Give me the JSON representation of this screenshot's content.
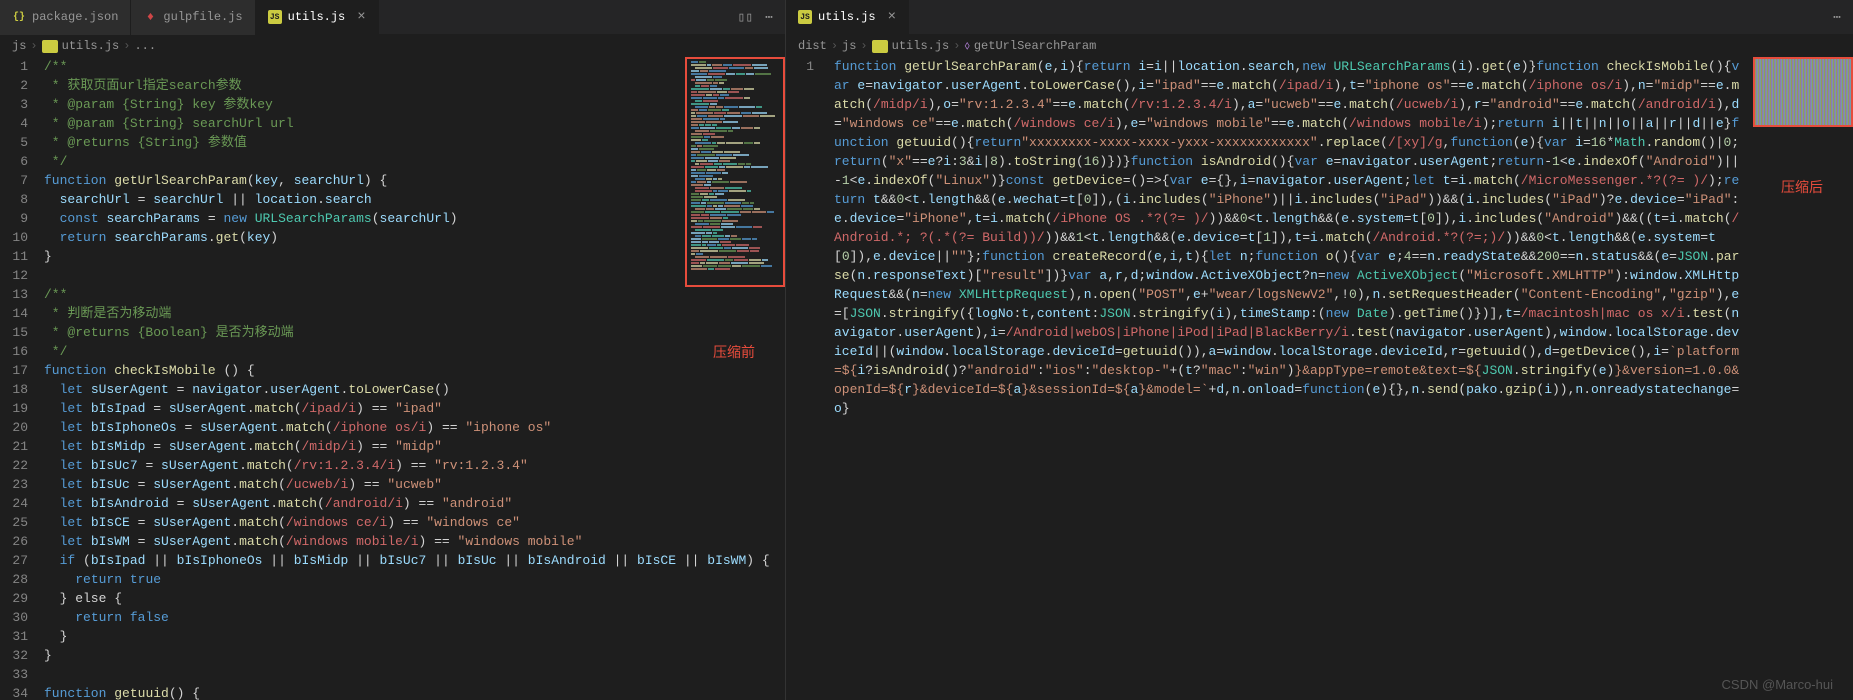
{
  "left": {
    "tabs": [
      {
        "icon": "json",
        "label": "package.json",
        "active": false
      },
      {
        "icon": "gulp",
        "label": "gulpfile.js",
        "active": false
      },
      {
        "icon": "js",
        "label": "utils.js",
        "active": true
      }
    ],
    "breadcrumb": [
      "js",
      "utils.js",
      "..."
    ],
    "minimap_label": "压缩前",
    "lines": [
      {
        "n": 1,
        "t": "/**",
        "cls": "c-comment"
      },
      {
        "n": 2,
        "t": " * 获取页面url指定search参数",
        "cls": "c-comment"
      },
      {
        "n": 3,
        "t": " * @param {String} key 参数key",
        "cls": "c-comment"
      },
      {
        "n": 4,
        "t": " * @param {String} searchUrl url",
        "cls": "c-comment"
      },
      {
        "n": 5,
        "t": " * @returns {String} 参数值",
        "cls": "c-comment"
      },
      {
        "n": 6,
        "t": " */",
        "cls": "c-comment"
      },
      {
        "n": 7,
        "html": "<span class='c-kw'>function</span> <span class='c-fn'>getUrlSearchParam</span>(<span class='c-var'>key</span>, <span class='c-var'>searchUrl</span>) {"
      },
      {
        "n": 8,
        "html": "  <span class='c-var'>searchUrl</span> = <span class='c-var'>searchUrl</span> || <span class='c-var'>location</span>.<span class='c-var'>search</span>"
      },
      {
        "n": 9,
        "html": "  <span class='c-kw'>const</span> <span class='c-var'>searchParams</span> = <span class='c-kw'>new</span> <span class='c-type'>URLSearchParams</span>(<span class='c-var'>searchUrl</span>)"
      },
      {
        "n": 10,
        "html": "  <span class='c-kw'>return</span> <span class='c-var'>searchParams</span>.<span class='c-fn'>get</span>(<span class='c-var'>key</span>)"
      },
      {
        "n": 11,
        "t": "}"
      },
      {
        "n": 12,
        "t": ""
      },
      {
        "n": 13,
        "t": "/**",
        "cls": "c-comment"
      },
      {
        "n": 14,
        "t": " * 判断是否为移动端",
        "cls": "c-comment"
      },
      {
        "n": 15,
        "t": " * @returns {Boolean} 是否为移动端",
        "cls": "c-comment"
      },
      {
        "n": 16,
        "t": " */",
        "cls": "c-comment"
      },
      {
        "n": 17,
        "html": "<span class='c-kw'>function</span> <span class='c-fn'>checkIsMobile</span> () {"
      },
      {
        "n": 18,
        "html": "  <span class='c-kw'>let</span> <span class='c-var'>sUserAgent</span> = <span class='c-var'>navigator</span>.<span class='c-var'>userAgent</span>.<span class='c-fn'>toLowerCase</span>()"
      },
      {
        "n": 19,
        "html": "  <span class='c-kw'>let</span> <span class='c-var'>bIsIpad</span> = <span class='c-var'>sUserAgent</span>.<span class='c-fn'>match</span>(<span class='c-regex'>/ipad/i</span>) == <span class='c-str'>\"ipad\"</span>"
      },
      {
        "n": 20,
        "html": "  <span class='c-kw'>let</span> <span class='c-var'>bIsIphoneOs</span> = <span class='c-var'>sUserAgent</span>.<span class='c-fn'>match</span>(<span class='c-regex'>/iphone os/i</span>) == <span class='c-str'>\"iphone os\"</span>"
      },
      {
        "n": 21,
        "html": "  <span class='c-kw'>let</span> <span class='c-var'>bIsMidp</span> = <span class='c-var'>sUserAgent</span>.<span class='c-fn'>match</span>(<span class='c-regex'>/midp/i</span>) == <span class='c-str'>\"midp\"</span>"
      },
      {
        "n": 22,
        "html": "  <span class='c-kw'>let</span> <span class='c-var'>bIsUc7</span> = <span class='c-var'>sUserAgent</span>.<span class='c-fn'>match</span>(<span class='c-regex'>/rv:1.2.3.4/i</span>) == <span class='c-str'>\"rv:1.2.3.4\"</span>"
      },
      {
        "n": 23,
        "html": "  <span class='c-kw'>let</span> <span class='c-var'>bIsUc</span> = <span class='c-var'>sUserAgent</span>.<span class='c-fn'>match</span>(<span class='c-regex'>/ucweb/i</span>) == <span class='c-str'>\"ucweb\"</span>"
      },
      {
        "n": 24,
        "html": "  <span class='c-kw'>let</span> <span class='c-var'>bIsAndroid</span> = <span class='c-var'>sUserAgent</span>.<span class='c-fn'>match</span>(<span class='c-regex'>/android/i</span>) == <span class='c-str'>\"android\"</span>"
      },
      {
        "n": 25,
        "html": "  <span class='c-kw'>let</span> <span class='c-var'>bIsCE</span> = <span class='c-var'>sUserAgent</span>.<span class='c-fn'>match</span>(<span class='c-regex'>/windows ce/i</span>) == <span class='c-str'>\"windows ce\"</span>"
      },
      {
        "n": 26,
        "html": "  <span class='c-kw'>let</span> <span class='c-var'>bIsWM</span> = <span class='c-var'>sUserAgent</span>.<span class='c-fn'>match</span>(<span class='c-regex'>/windows mobile/i</span>) == <span class='c-str'>\"windows mobile\"</span>"
      },
      {
        "n": 27,
        "html": "  <span class='c-kw'>if</span> (<span class='c-var'>bIsIpad</span> || <span class='c-var'>bIsIphoneOs</span> || <span class='c-var'>bIsMidp</span> || <span class='c-var'>bIsUc7</span> || <span class='c-var'>bIsUc</span> || <span class='c-var'>bIsAndroid</span> || <span class='c-var'>bIsCE</span> || <span class='c-var'>bIsWM</span>) {"
      },
      {
        "n": 28,
        "html": "    <span class='c-kw'>return</span> <span class='c-const'>true</span>"
      },
      {
        "n": 29,
        "t": "  } else {"
      },
      {
        "n": 30,
        "html": "    <span class='c-kw'>return</span> <span class='c-const'>false</span>"
      },
      {
        "n": 31,
        "t": "  }"
      },
      {
        "n": 32,
        "t": "}"
      },
      {
        "n": 33,
        "t": ""
      },
      {
        "n": 34,
        "html": "<span class='c-kw'>function</span> <span class='c-fn'>getuuid</span>() {"
      }
    ]
  },
  "right": {
    "tabs": [
      {
        "icon": "js",
        "label": "utils.js",
        "active": true
      }
    ],
    "breadcrumb": [
      "dist",
      "js",
      "utils.js",
      "getUrlSearchParam"
    ],
    "minimap_label": "压缩后",
    "line_num": "1",
    "code_html": "<span class='c-kw'>function</span> <span class='c-fn'>getUrlSearchParam</span>(<span class='c-var'>e</span>,<span class='c-var'>i</span>){<span class='c-kw'>return</span> <span class='c-var'>i</span>=<span class='c-var'>i</span>||<span class='c-var'>location</span>.<span class='c-var'>search</span>,<span class='c-kw'>new</span> <span class='c-type'>URLSearchParams</span>(<span class='c-var'>i</span>).<span class='c-fn'>get</span>(<span class='c-var'>e</span>)}<span class='c-kw'>function</span> <span class='c-fn'>checkIsMobile</span>(){<span class='c-kw'>var</span> <span class='c-var'>e</span>=<span class='c-var'>navigator</span>.<span class='c-var'>userAgent</span>.<span class='c-fn'>toLowerCase</span>(),<span class='c-var'>i</span>=<span class='c-str'>\"ipad\"</span>==<span class='c-var'>e</span>.<span class='c-fn'>match</span>(<span class='c-regex'>/ipad/i</span>),<span class='c-var'>t</span>=<span class='c-str'>\"iphone os\"</span>==<span class='c-var'>e</span>.<span class='c-fn'>match</span>(<span class='c-regex'>/iphone os/i</span>),<span class='c-var'>n</span>=<span class='c-str'>\"midp\"</span>==<span class='c-var'>e</span>.<span class='c-fn'>match</span>(<span class='c-regex'>/midp/i</span>),<span class='c-var'>o</span>=<span class='c-str'>\"rv:1.2.3.4\"</span>==<span class='c-var'>e</span>.<span class='c-fn'>match</span>(<span class='c-regex'>/rv:1.2.3.4/i</span>),<span class='c-var'>a</span>=<span class='c-str'>\"ucweb\"</span>==<span class='c-var'>e</span>.<span class='c-fn'>match</span>(<span class='c-regex'>/ucweb/i</span>),<span class='c-var'>r</span>=<span class='c-str'>\"android\"</span>==<span class='c-var'>e</span>.<span class='c-fn'>match</span>(<span class='c-regex'>/android/i</span>),<span class='c-var'>d</span>=<span class='c-str'>\"windows ce\"</span>==<span class='c-var'>e</span>.<span class='c-fn'>match</span>(<span class='c-regex'>/windows ce/i</span>),<span class='c-var'>e</span>=<span class='c-str'>\"windows mobile\"</span>==<span class='c-var'>e</span>.<span class='c-fn'>match</span>(<span class='c-regex'>/windows mobile/i</span>);<span class='c-kw'>return</span> <span class='c-var'>i</span>||<span class='c-var'>t</span>||<span class='c-var'>n</span>||<span class='c-var'>o</span>||<span class='c-var'>a</span>||<span class='c-var'>r</span>||<span class='c-var'>d</span>||<span class='c-var'>e</span>}<span class='c-kw'>function</span> <span class='c-fn'>getuuid</span>(){<span class='c-kw'>return</span><span class='c-str'>\"xxxxxxxx-xxxx-xxxx-yxxx-xxxxxxxxxxxx\"</span>.<span class='c-fn'>replace</span>(<span class='c-regex'>/[xy]/g</span>,<span class='c-kw'>function</span>(<span class='c-var'>e</span>){<span class='c-kw'>var</span> <span class='c-var'>i</span>=<span class='c-num'>16</span>*<span class='c-type'>Math</span>.<span class='c-fn'>random</span>()|<span class='c-num'>0</span>;<span class='c-kw'>return</span>(<span class='c-str'>\"x\"</span>==<span class='c-var'>e</span>?<span class='c-var'>i</span>:<span class='c-num'>3</span>&<span class='c-var'>i</span>|<span class='c-num'>8</span>).<span class='c-fn'>toString</span>(<span class='c-num'>16</span>)})}<span class='c-kw'>function</span> <span class='c-fn'>isAndroid</span>(){<span class='c-kw'>var</span> <span class='c-var'>e</span>=<span class='c-var'>navigator</span>.<span class='c-var'>userAgent</span>;<span class='c-kw'>return</span>-<span class='c-num'>1</span>&lt;<span class='c-var'>e</span>.<span class='c-fn'>indexOf</span>(<span class='c-str'>\"Android\"</span>)||-<span class='c-num'>1</span>&lt;<span class='c-var'>e</span>.<span class='c-fn'>indexOf</span>(<span class='c-str'>\"Linux\"</span>)}<span class='c-kw'>const</span> <span class='c-fn'>getDevice</span>=()=&gt;{<span class='c-kw'>var</span> <span class='c-var'>e</span>={},<span class='c-var'>i</span>=<span class='c-var'>navigator</span>.<span class='c-var'>userAgent</span>;<span class='c-kw'>let</span> <span class='c-var'>t</span>=<span class='c-var'>i</span>.<span class='c-fn'>match</span>(<span class='c-regex'>/MicroMessenger.*?(?= )/</span>);<span class='c-kw'>return</span> <span class='c-var'>t</span>&amp;&amp;<span class='c-num'>0</span>&lt;<span class='c-var'>t</span>.<span class='c-var'>length</span>&amp;&amp;(<span class='c-var'>e</span>.<span class='c-var'>wechat</span>=<span class='c-var'>t</span>[<span class='c-num'>0</span>]),(<span class='c-var'>i</span>.<span class='c-fn'>includes</span>(<span class='c-str'>\"iPhone\"</span>)||<span class='c-var'>i</span>.<span class='c-fn'>includes</span>(<span class='c-str'>\"iPad\"</span>))&amp;&amp;(<span class='c-var'>i</span>.<span class='c-fn'>includes</span>(<span class='c-str'>\"iPad\"</span>)?<span class='c-var'>e</span>.<span class='c-var'>device</span>=<span class='c-str'>\"iPad\"</span>:<span class='c-var'>e</span>.<span class='c-var'>device</span>=<span class='c-str'>\"iPhone\"</span>,<span class='c-var'>t</span>=<span class='c-var'>i</span>.<span class='c-fn'>match</span>(<span class='c-regex'>/iPhone OS .*?(?= )/</span>))&amp;&amp;<span class='c-num'>0</span>&lt;<span class='c-var'>t</span>.<span class='c-var'>length</span>&amp;&amp;(<span class='c-var'>e</span>.<span class='c-var'>system</span>=<span class='c-var'>t</span>[<span class='c-num'>0</span>]),<span class='c-var'>i</span>.<span class='c-fn'>includes</span>(<span class='c-str'>\"Android\"</span>)&amp;&amp;((<span class='c-var'>t</span>=<span class='c-var'>i</span>.<span class='c-fn'>match</span>(<span class='c-regex'>/Android.*; ?(.*(?= Build))/</span>))&amp;&amp;<span class='c-num'>1</span>&lt;<span class='c-var'>t</span>.<span class='c-var'>length</span>&amp;&amp;(<span class='c-var'>e</span>.<span class='c-var'>device</span>=<span class='c-var'>t</span>[<span class='c-num'>1</span>]),<span class='c-var'>t</span>=<span class='c-var'>i</span>.<span class='c-fn'>match</span>(<span class='c-regex'>/Android.*?(?=;)/</span>))&amp;&amp;<span class='c-num'>0</span>&lt;<span class='c-var'>t</span>.<span class='c-var'>length</span>&amp;&amp;(<span class='c-var'>e</span>.<span class='c-var'>system</span>=<span class='c-var'>t</span>[<span class='c-num'>0</span>]),<span class='c-var'>e</span>.<span class='c-var'>device</span>||<span class='c-str'>\"\"</span>};<span class='c-kw'>function</span> <span class='c-fn'>createRecord</span>(<span class='c-var'>e</span>,<span class='c-var'>i</span>,<span class='c-var'>t</span>){<span class='c-kw'>let</span> <span class='c-var'>n</span>;<span class='c-kw'>function</span> <span class='c-fn'>o</span>(){<span class='c-kw'>var</span> <span class='c-var'>e</span>;<span class='c-num'>4</span>==<span class='c-var'>n</span>.<span class='c-var'>readyState</span>&amp;&amp;<span class='c-num'>200</span>==<span class='c-var'>n</span>.<span class='c-var'>status</span>&amp;&amp;(<span class='c-var'>e</span>=<span class='c-type'>JSON</span>.<span class='c-fn'>parse</span>(<span class='c-var'>n</span>.<span class='c-var'>responseText</span>)[<span class='c-str'>\"result\"</span>])}<span class='c-kw'>var</span> <span class='c-var'>a</span>,<span class='c-var'>r</span>,<span class='c-var'>d</span>;<span class='c-var'>window</span>.<span class='c-var'>ActiveXObject</span>?<span class='c-var'>n</span>=<span class='c-kw'>new</span> <span class='c-type'>ActiveXObject</span>(<span class='c-str'>\"Microsoft.XMLHTTP\"</span>):<span class='c-var'>window</span>.<span class='c-var'>XMLHttpRequest</span>&amp;&amp;(<span class='c-var'>n</span>=<span class='c-kw'>new</span> <span class='c-type'>XMLHttpRequest</span>),<span class='c-var'>n</span>.<span class='c-fn'>open</span>(<span class='c-str'>\"POST\"</span>,<span class='c-var'>e</span>+<span class='c-str'>\"wear/logsNewV2\"</span>,!<span class='c-num'>0</span>),<span class='c-var'>n</span>.<span class='c-fn'>setRequestHeader</span>(<span class='c-str'>\"Content-Encoding\"</span>,<span class='c-str'>\"gzip\"</span>),<span class='c-var'>e</span>=[<span class='c-type'>JSON</span>.<span class='c-fn'>stringify</span>({<span class='c-var'>logNo</span>:<span class='c-var'>t</span>,<span class='c-var'>content</span>:<span class='c-type'>JSON</span>.<span class='c-fn'>stringify</span>(<span class='c-var'>i</span>),<span class='c-var'>timeStamp</span>:(<span class='c-kw'>new</span> <span class='c-type'>Date</span>).<span class='c-fn'>getTime</span>()})],<span class='c-var'>t</span>=<span class='c-regex'>/macintosh|mac os x/i</span>.<span class='c-fn'>test</span>(<span class='c-var'>navigator</span>.<span class='c-var'>userAgent</span>),<span class='c-var'>i</span>=<span class='c-regex'>/Android|webOS|iPhone|iPod|iPad|BlackBerry/i</span>.<span class='c-fn'>test</span>(<span class='c-var'>navigator</span>.<span class='c-var'>userAgent</span>),<span class='c-var'>window</span>.<span class='c-var'>localStorage</span>.<span class='c-var'>deviceId</span>||(<span class='c-var'>window</span>.<span class='c-var'>localStorage</span>.<span class='c-var'>deviceId</span>=<span class='c-fn'>getuuid</span>()),<span class='c-var'>a</span>=<span class='c-var'>window</span>.<span class='c-var'>localStorage</span>.<span class='c-var'>deviceId</span>,<span class='c-var'>r</span>=<span class='c-fn'>getuuid</span>(),<span class='c-var'>d</span>=<span class='c-fn'>getDevice</span>(),<span class='c-var'>i</span>=<span class='c-str'>`platform=${</span><span class='c-var'>i</span>?<span class='c-fn'>isAndroid</span>()?<span class='c-str'>\"android\"</span>:<span class='c-str'>\"ios\"</span>:<span class='c-str'>\"desktop-\"</span>+(<span class='c-var'>t</span>?<span class='c-str'>\"mac\"</span>:<span class='c-str'>\"win\"</span>)<span class='c-str'>}&amp;appType=remote&amp;text=${</span><span class='c-type'>JSON</span>.<span class='c-fn'>stringify</span>(<span class='c-var'>e</span>)<span class='c-str'>}&amp;version=1.0.0&amp;openId=${</span><span class='c-var'>r</span><span class='c-str'>}&amp;deviceId=${</span><span class='c-var'>a</span><span class='c-str'>}&amp;sessionId=${</span><span class='c-var'>a</span><span class='c-str'>}&amp;model=`</span>+<span class='c-var'>d</span>,<span class='c-var'>n</span>.<span class='c-var'>onload</span>=<span class='c-kw'>function</span>(<span class='c-var'>e</span>){},<span class='c-var'>n</span>.<span class='c-fn'>send</span>(<span class='c-var'>pako</span>.<span class='c-fn'>gzip</span>(<span class='c-var'>i</span>)),<span class='c-var'>n</span>.<span class='c-var'>onreadystatechange</span>=<span class='c-var'>o</span>}"
  },
  "watermark": "CSDN @Marco-hui"
}
